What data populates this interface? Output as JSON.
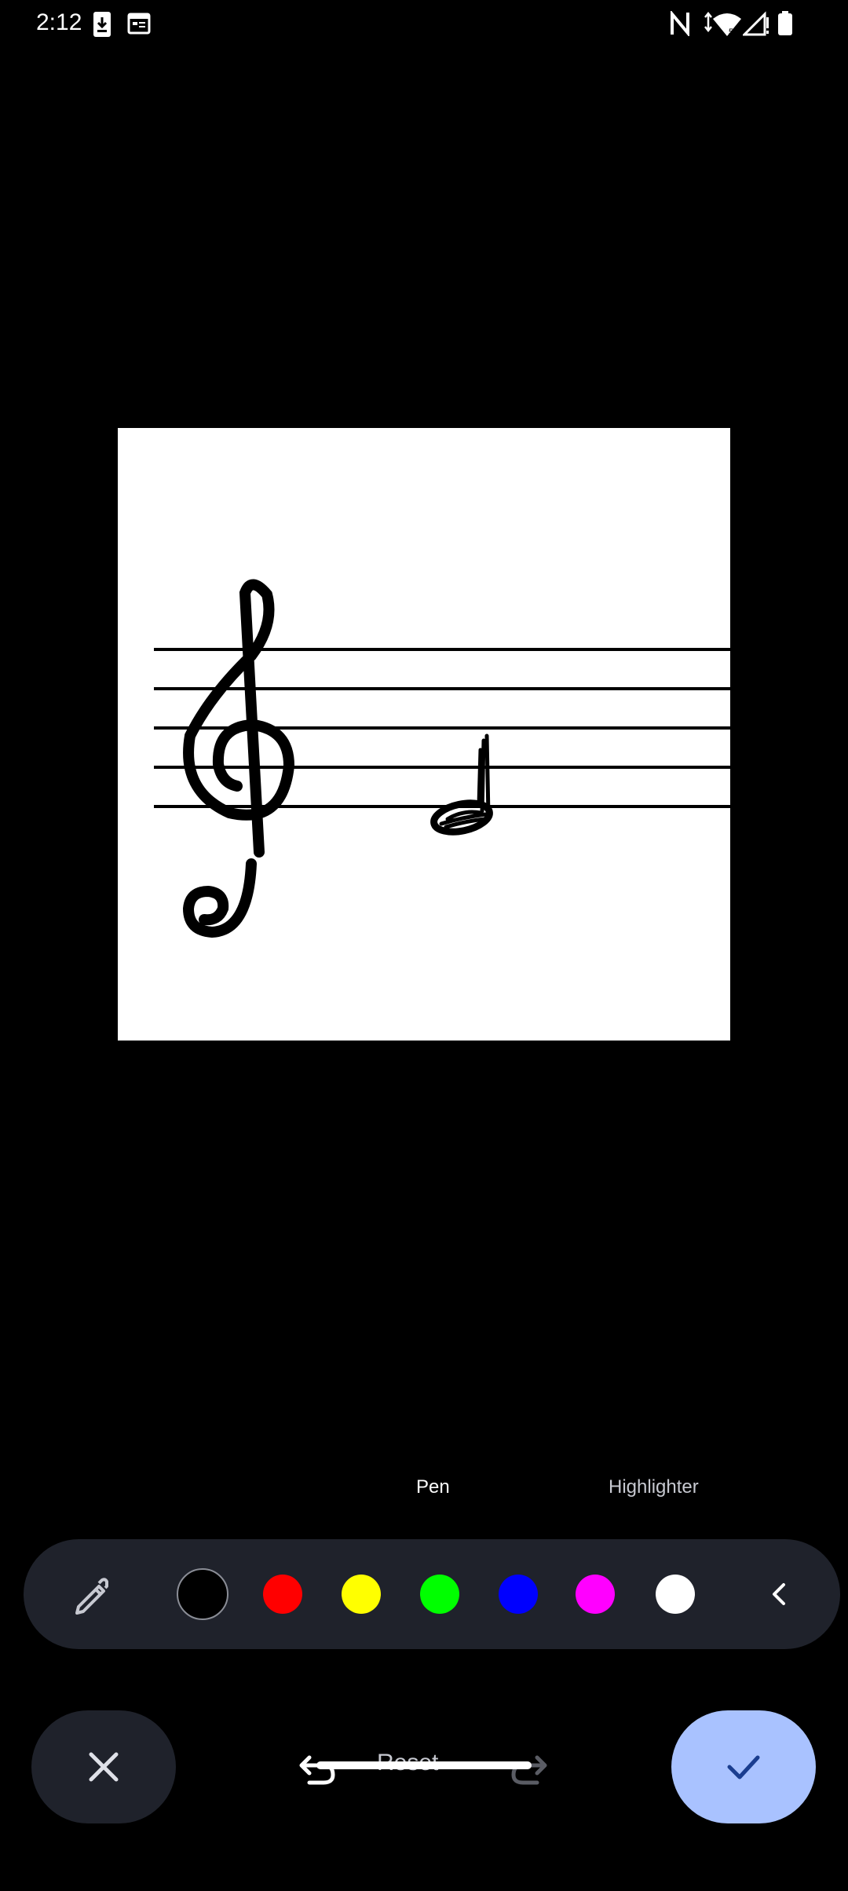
{
  "status_bar": {
    "time": "2:12",
    "icons": [
      "download-icon",
      "calendar-icon",
      "nfc-icon",
      "wifi-icon",
      "signal-icon",
      "battery-icon"
    ]
  },
  "editor": {
    "tools": {
      "pen_label": "Pen",
      "highlighter_label": "Highlighter",
      "selected": "Pen"
    },
    "colors": [
      {
        "name": "black",
        "hex": "#000000",
        "selected": true
      },
      {
        "name": "red",
        "hex": "#ff0000",
        "selected": false
      },
      {
        "name": "yellow",
        "hex": "#ffff00",
        "selected": false
      },
      {
        "name": "green",
        "hex": "#00ff00",
        "selected": false
      },
      {
        "name": "blue",
        "hex": "#0000ff",
        "selected": false
      },
      {
        "name": "magenta",
        "hex": "#ff00ff",
        "selected": false
      },
      {
        "name": "white",
        "hex": "#ffffff",
        "selected": false
      }
    ],
    "actions": {
      "reset_label": "Reset"
    },
    "accent_color": "#a9c2ff"
  }
}
